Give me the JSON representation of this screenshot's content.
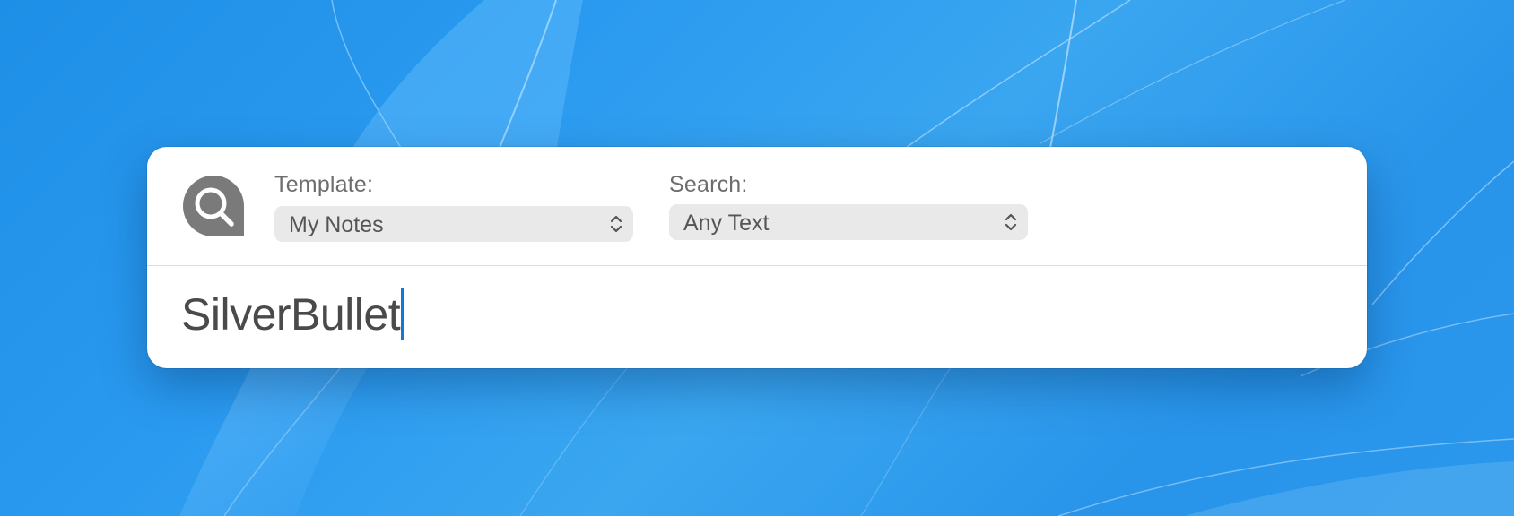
{
  "window": {
    "template_label": "Template:",
    "template_value": "My Notes",
    "search_label": "Search:",
    "search_value": "Any Text",
    "query_text": "SilverBullet"
  },
  "icons": {
    "app_icon": "search-bubble-icon",
    "select_chevron": "up-down-chevron-icon"
  },
  "colors": {
    "wallpaper": "#2a9af0",
    "caret": "#1a73d6",
    "app_icon": "#7a7a7a"
  }
}
